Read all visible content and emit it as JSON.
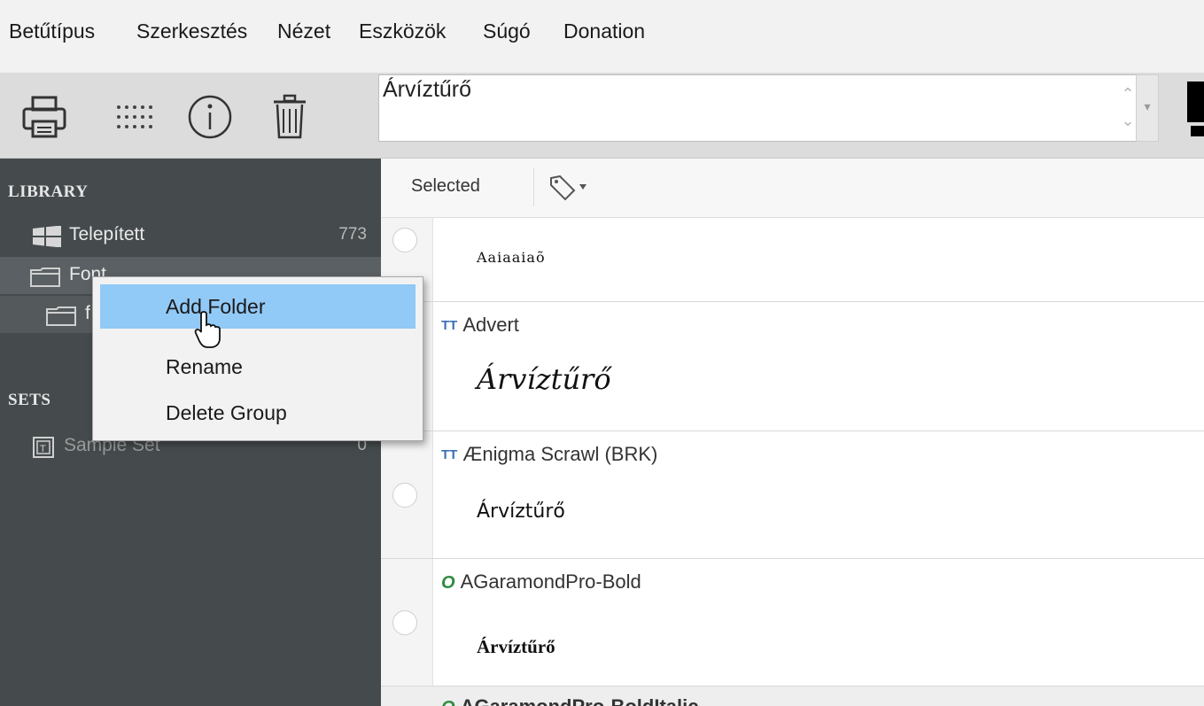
{
  "menu": [
    "Betűtípus",
    "Szerkesztés",
    "Nézet",
    "Eszközök",
    "Súgó",
    "Donation"
  ],
  "toolbar": {
    "icons": [
      "printer-icon",
      "grid-dots-icon",
      "info-icon",
      "trash-icon"
    ],
    "sample_text": "Árvíztűrő"
  },
  "sidebar": {
    "library_heading": "LIBRARY",
    "sets_heading": "SETS",
    "items": [
      {
        "label": "Telepített",
        "count": "773"
      },
      {
        "label": "Font",
        "count": ""
      },
      {
        "label": "f",
        "count": ""
      }
    ],
    "sets": [
      {
        "label": "Sample Set",
        "count": "0"
      }
    ]
  },
  "list_header": {
    "selected_label": "Selected",
    "tag_icon": "tag-dropdown-icon"
  },
  "fonts": [
    {
      "name": "",
      "type": "",
      "sample": "Aaiaaiaõ"
    },
    {
      "name": "Advert",
      "type": "TT",
      "sample": "Árvíztűrő"
    },
    {
      "name": "Ænigma Scrawl (BRK)",
      "type": "TT",
      "sample": "Árvíztűrő"
    },
    {
      "name": "AGaramondPro-Bold",
      "type": "O",
      "sample": "Árvíztűrő"
    },
    {
      "name": "AGaramondPro-BoldItalic",
      "type": "O",
      "sample": ""
    }
  ],
  "context_menu": {
    "items": [
      "Add Folder",
      "Rename",
      "Delete Group"
    ],
    "highlighted": "Add Folder"
  },
  "colors": {
    "sidebar_bg": "#454b4d",
    "menu_highlight": "#91c9f7",
    "toolbar_bg": "#dcdcdc"
  }
}
